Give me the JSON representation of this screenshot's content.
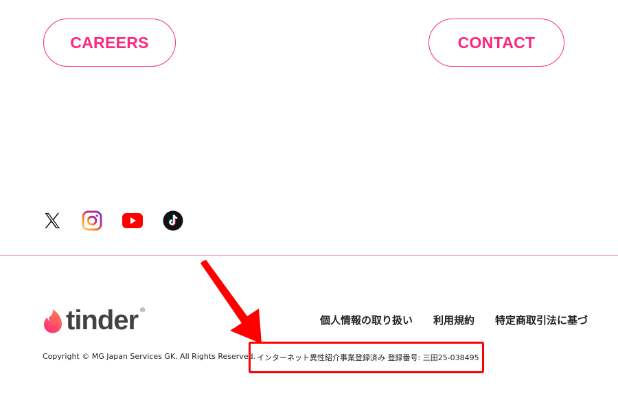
{
  "nav": {
    "careers_label": "CAREERS",
    "contact_label": "CONTACT"
  },
  "social": {
    "items": [
      {
        "icon": "x-icon",
        "label": "X"
      },
      {
        "icon": "instagram-icon",
        "label": "Instagram"
      },
      {
        "icon": "youtube-icon",
        "label": "YouTube"
      },
      {
        "icon": "tiktok-icon",
        "label": "TikTok"
      }
    ]
  },
  "footer": {
    "logo_text": "tinder",
    "logo_reg": "®",
    "links": [
      "個人情報の取り扱い",
      "利用規約",
      "特定商取引法に基づ"
    ],
    "copyright": "Copyright © MG Japan Services GK. All Rights Reserved.",
    "registration": "インターネット異性紹介事業登録済み 登録番号: 三田25-038495"
  },
  "colors": {
    "brand_pink": "#fd267d",
    "annotation_red": "#ff0000",
    "divider": "#f2a0c0"
  }
}
